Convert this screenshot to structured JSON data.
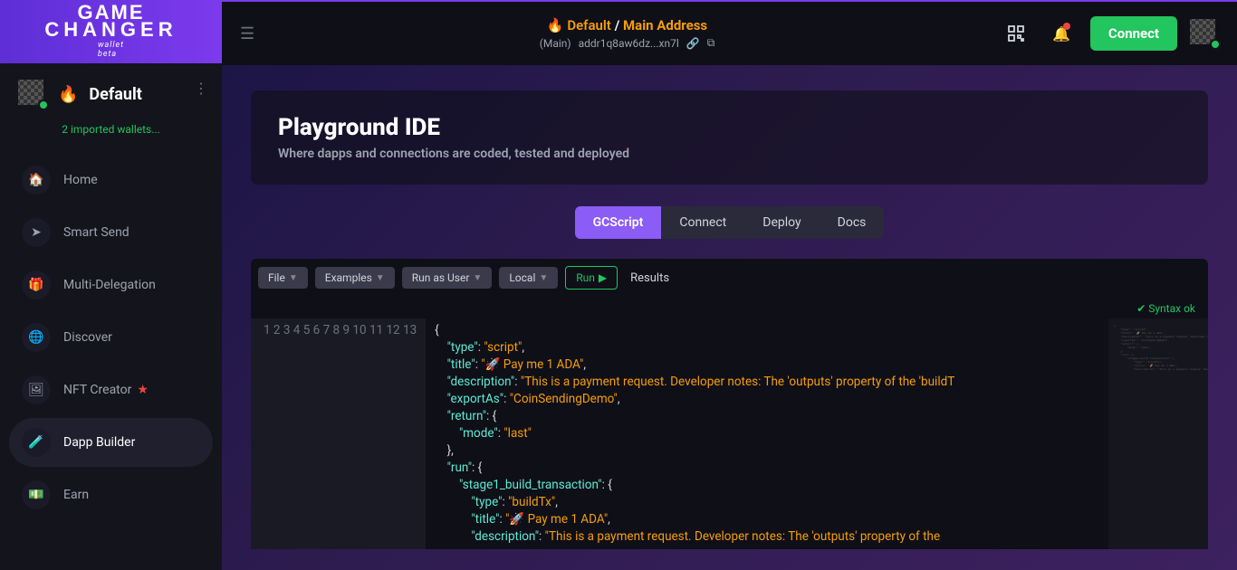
{
  "logo": {
    "line1": "GAME",
    "line2": "CHANGER",
    "sub": "wallet\nbeta"
  },
  "sidebar": {
    "walletName": "Default",
    "imported": "2 imported wallets...",
    "items": [
      {
        "label": "Home",
        "icon": "🏠"
      },
      {
        "label": "Smart Send",
        "icon": "➤"
      },
      {
        "label": "Multi-Delegation",
        "icon": "🎁"
      },
      {
        "label": "Discover",
        "icon": "🌐"
      },
      {
        "label": "NFT Creator",
        "icon": "🖼",
        "starred": true
      },
      {
        "label": "Dapp Builder",
        "icon": "🧪",
        "active": true
      },
      {
        "label": "Earn",
        "icon": "💵"
      }
    ]
  },
  "topbar": {
    "breadcrumb": {
      "default": "Default",
      "sep": " / ",
      "main": "Main Address"
    },
    "address": {
      "prefix": "(Main)",
      "value": "addr1q8aw6dz...xn7l"
    },
    "connect": "Connect"
  },
  "page": {
    "title": "Playground IDE",
    "subtitle": "Where dapps and connections are coded, tested and deployed"
  },
  "tabs": [
    "GCScript",
    "Connect",
    "Deploy",
    "Docs"
  ],
  "toolbar": {
    "file": "File",
    "examples": "Examples",
    "runas": "Run as User",
    "local": "Local",
    "run": "Run",
    "results": "Results"
  },
  "syntax": "Syntax ok",
  "code": {
    "lines": [
      {
        "n": 1,
        "t": [
          {
            "c": "s-punc",
            "v": "{"
          }
        ]
      },
      {
        "n": 2,
        "t": [
          {
            "c": "",
            "v": "    "
          },
          {
            "c": "s-key",
            "v": "\"type\""
          },
          {
            "c": "s-punc",
            "v": ": "
          },
          {
            "c": "s-str",
            "v": "\"script\""
          },
          {
            "c": "s-punc",
            "v": ","
          }
        ]
      },
      {
        "n": 3,
        "t": [
          {
            "c": "",
            "v": "    "
          },
          {
            "c": "s-key",
            "v": "\"title\""
          },
          {
            "c": "s-punc",
            "v": ": "
          },
          {
            "c": "s-str",
            "v": "\"🚀 Pay me 1 ADA\""
          },
          {
            "c": "s-punc",
            "v": ","
          }
        ]
      },
      {
        "n": 4,
        "t": [
          {
            "c": "",
            "v": "    "
          },
          {
            "c": "s-key",
            "v": "\"description\""
          },
          {
            "c": "s-punc",
            "v": ": "
          },
          {
            "c": "s-str",
            "v": "\"This is a payment request. Developer notes: The 'outputs' property of the 'buildT"
          }
        ]
      },
      {
        "n": 5,
        "t": [
          {
            "c": "",
            "v": "    "
          },
          {
            "c": "s-key",
            "v": "\"exportAs\""
          },
          {
            "c": "s-punc",
            "v": ": "
          },
          {
            "c": "s-str",
            "v": "\"CoinSendingDemo\""
          },
          {
            "c": "s-punc",
            "v": ","
          }
        ]
      },
      {
        "n": 6,
        "t": [
          {
            "c": "",
            "v": "    "
          },
          {
            "c": "s-key",
            "v": "\"return\""
          },
          {
            "c": "s-punc",
            "v": ": {"
          }
        ]
      },
      {
        "n": 7,
        "t": [
          {
            "c": "",
            "v": "        "
          },
          {
            "c": "s-key",
            "v": "\"mode\""
          },
          {
            "c": "s-punc",
            "v": ": "
          },
          {
            "c": "s-str",
            "v": "\"last\""
          }
        ]
      },
      {
        "n": 8,
        "t": [
          {
            "c": "",
            "v": "    "
          },
          {
            "c": "s-punc",
            "v": "},"
          }
        ]
      },
      {
        "n": 9,
        "t": [
          {
            "c": "",
            "v": "    "
          },
          {
            "c": "s-key",
            "v": "\"run\""
          },
          {
            "c": "s-punc",
            "v": ": {"
          }
        ]
      },
      {
        "n": 10,
        "t": [
          {
            "c": "",
            "v": "        "
          },
          {
            "c": "s-key",
            "v": "\"stage1_build_transaction\""
          },
          {
            "c": "s-punc",
            "v": ": {"
          }
        ]
      },
      {
        "n": 11,
        "t": [
          {
            "c": "",
            "v": "            "
          },
          {
            "c": "s-key",
            "v": "\"type\""
          },
          {
            "c": "s-punc",
            "v": ": "
          },
          {
            "c": "s-str",
            "v": "\"buildTx\""
          },
          {
            "c": "s-punc",
            "v": ","
          }
        ]
      },
      {
        "n": 12,
        "t": [
          {
            "c": "",
            "v": "            "
          },
          {
            "c": "s-key",
            "v": "\"title\""
          },
          {
            "c": "s-punc",
            "v": ": "
          },
          {
            "c": "s-str",
            "v": "\"🚀 Pay me 1 ADA\""
          },
          {
            "c": "s-punc",
            "v": ","
          }
        ]
      },
      {
        "n": 13,
        "t": [
          {
            "c": "",
            "v": "            "
          },
          {
            "c": "s-key",
            "v": "\"description\""
          },
          {
            "c": "s-punc",
            "v": ": "
          },
          {
            "c": "s-str",
            "v": "\"This is a payment request. Developer notes: The 'outputs' property of the"
          }
        ]
      }
    ]
  }
}
